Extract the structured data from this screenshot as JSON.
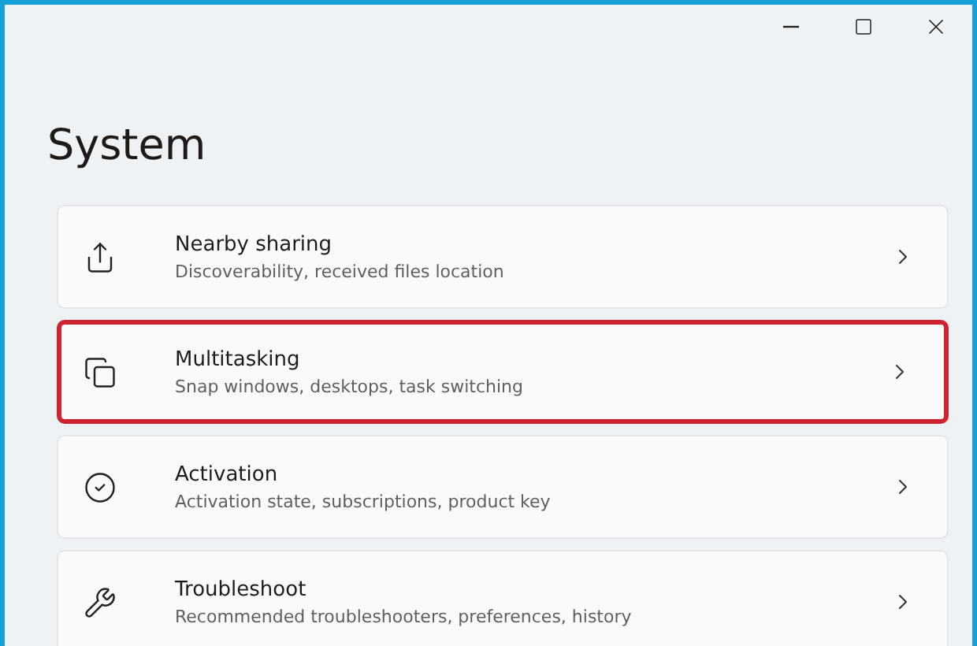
{
  "window": {
    "title": "System"
  },
  "items": [
    {
      "title": "Nearby sharing",
      "description": "Discoverability, received files location",
      "highlighted": false
    },
    {
      "title": "Multitasking",
      "description": "Snap windows, desktops, task switching",
      "highlighted": true
    },
    {
      "title": "Activation",
      "description": "Activation state, subscriptions, product key",
      "highlighted": false
    },
    {
      "title": "Troubleshoot",
      "description": "Recommended troubleshooters, preferences, history",
      "highlighted": false
    }
  ]
}
